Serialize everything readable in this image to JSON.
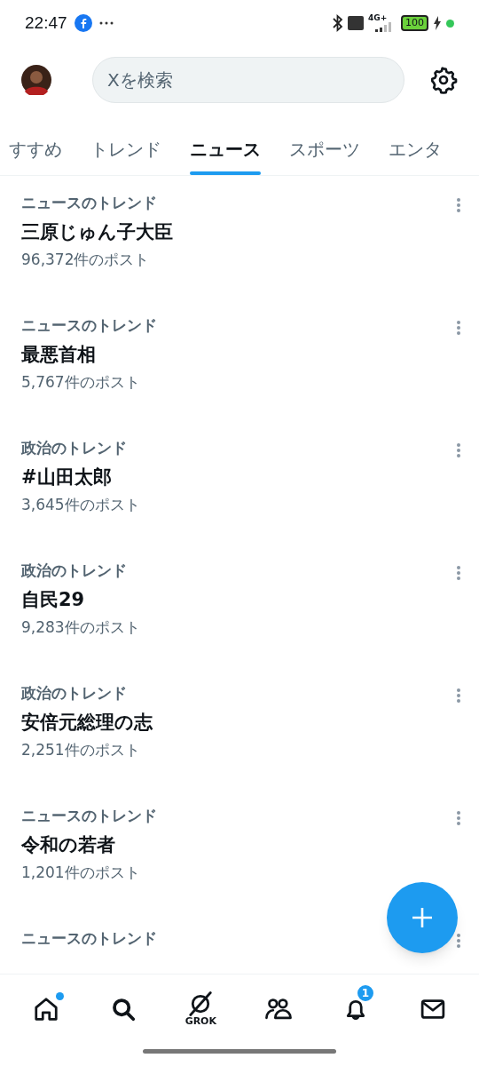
{
  "status_bar": {
    "time": "22:47",
    "network": "4G+",
    "battery": "100"
  },
  "header": {
    "search": {
      "placeholder": "Xを検索"
    }
  },
  "tabs": [
    {
      "label": "すすめ",
      "selected": false
    },
    {
      "label": "トレンド",
      "selected": false
    },
    {
      "label": "ニュース",
      "selected": true
    },
    {
      "label": "スポーツ",
      "selected": false
    },
    {
      "label": "エンタ",
      "selected": false
    }
  ],
  "trends": [
    {
      "category": "ニュースのトレンド",
      "title": "三原じゅん子大臣",
      "posts": "96,372件のポスト"
    },
    {
      "category": "ニュースのトレンド",
      "title": "最悪首相",
      "posts": "5,767件のポスト"
    },
    {
      "category": "政治のトレンド",
      "title": "#山田太郎",
      "posts": "3,645件のポスト"
    },
    {
      "category": "政治のトレンド",
      "title": "自民29",
      "posts": "9,283件のポスト"
    },
    {
      "category": "政治のトレンド",
      "title": "安倍元総理の志",
      "posts": "2,251件のポスト"
    },
    {
      "category": "ニュースのトレンド",
      "title": "令和の若者",
      "posts": "1,201件のポスト"
    },
    {
      "category": "ニュースのトレンド"
    }
  ],
  "bottom_nav": [
    {
      "kind": "home",
      "dot": true
    },
    {
      "kind": "search"
    },
    {
      "kind": "grok",
      "label": "GROK"
    },
    {
      "kind": "people"
    },
    {
      "kind": "bell",
      "badge": "1"
    },
    {
      "kind": "mail"
    }
  ]
}
